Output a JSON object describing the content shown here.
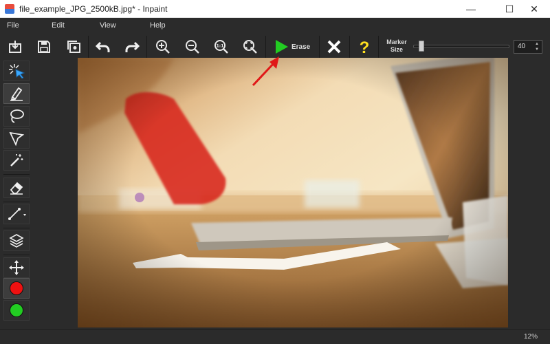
{
  "window": {
    "title": "file_example_JPG_2500kB.jpg* - Inpaint",
    "minimize_glyph": "—",
    "maximize_glyph": "☐",
    "close_glyph": "✕"
  },
  "menu": {
    "items": [
      "File",
      "Edit",
      "View",
      "Help"
    ]
  },
  "toolbar": {
    "buttons": [
      "open-icon",
      "save-icon",
      "save-copy-icon",
      "undo-icon",
      "redo-icon",
      "zoom-in-icon",
      "zoom-out-icon",
      "zoom-actual-icon",
      "zoom-fit-icon"
    ],
    "erase_label": "Erase",
    "cancel_icon": "close-icon",
    "help_icon": "help-icon",
    "marker_label": "Marker Size",
    "marker_size_value": "40",
    "marker_size_max": 400,
    "colors": {
      "play": "#22cc22",
      "cancel": "#ffffff",
      "help": "#ffe020"
    }
  },
  "tools": {
    "items": [
      "select-icon",
      "marker-icon",
      "lasso-icon",
      "polygonal-lasso-icon",
      "magic-wand-icon",
      "eraser-icon",
      "line-icon",
      "layers-icon",
      "move-icon"
    ],
    "colors": {
      "red": "#ee1111",
      "green": "#22cc22"
    }
  },
  "status": {
    "zoom": "12%"
  }
}
